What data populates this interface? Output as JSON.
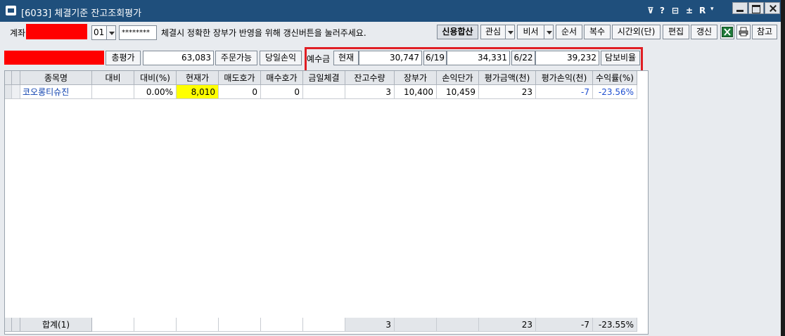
{
  "window": {
    "title": "[6033] 체결기준 잔고조회평가",
    "tool_icons": [
      "⊽",
      "?",
      "⊟",
      "±",
      "R",
      "▾"
    ]
  },
  "toolbar": {
    "account_label": "계좌",
    "account_suffix": "01",
    "password_mask": "********",
    "notice": "체결시 정확한 장부가 반영을 위해 갱신버튼을 눌러주세요.",
    "buttons": {
      "credit_sum": "신용합산",
      "watch": "관심",
      "secretary": "비서",
      "order": "순서",
      "copy": "복수",
      "after_hours": "시간외(단)",
      "edit": "편집",
      "refresh": "갱신",
      "reference": "참고"
    }
  },
  "summary": {
    "total_eval_label": "총평가",
    "total_eval_value": "63,083",
    "order_possible_label": "주문가능",
    "daily_pnl_label": "당일손익",
    "deposit_label": "예수금",
    "current_label": "현재",
    "current_value": "30,747",
    "d1_label": "6/19",
    "d1_value": "34,331",
    "d2_label": "6/22",
    "d2_value": "39,232",
    "collateral_label": "담보비율"
  },
  "grid": {
    "columns": [
      "종목명",
      "대비",
      "대비(%)",
      "현재가",
      "매도호가",
      "매수호가",
      "금일체결",
      "잔고수량",
      "장부가",
      "손익단가",
      "평가금액(천)",
      "평가손익(천)",
      "수익률(%)"
    ],
    "rows": [
      [
        "코오롱티슈진",
        "",
        "0.00%",
        "8,010",
        "0",
        "0",
        "",
        "3",
        "10,400",
        "10,459",
        "23",
        "-7",
        "-23.56%"
      ]
    ],
    "total": [
      "합계(1)",
      "",
      "",
      "",
      "",
      "",
      "",
      "3",
      "",
      "",
      "23",
      "-7",
      "-23.55%"
    ]
  },
  "colors": {
    "title_bar": "#1f4f7c",
    "highlight_border": "#e01e24",
    "price_highlight": "#ffff00",
    "negative_blue": "#1f4fd0",
    "name_blue": "#0b3fae"
  }
}
